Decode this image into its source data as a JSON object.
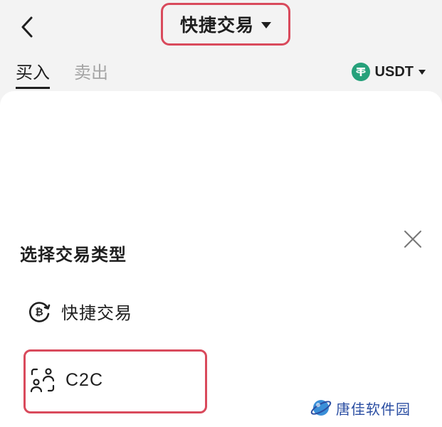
{
  "header": {
    "title": "快捷交易"
  },
  "tabs": [
    {
      "label": "买入"
    },
    {
      "label": "卖出"
    }
  ],
  "currency": {
    "label": "USDT",
    "icon": "tether-icon",
    "color": "#26a17b"
  },
  "sheet": {
    "title": "选择交易类型",
    "options": [
      {
        "label": "快捷交易",
        "icon": "coin-exchange-icon"
      },
      {
        "label": "C2C",
        "icon": "peer-to-peer-icon"
      }
    ]
  },
  "highlight_color": "#d94a5c",
  "watermark": {
    "text": "唐佳软件园"
  }
}
